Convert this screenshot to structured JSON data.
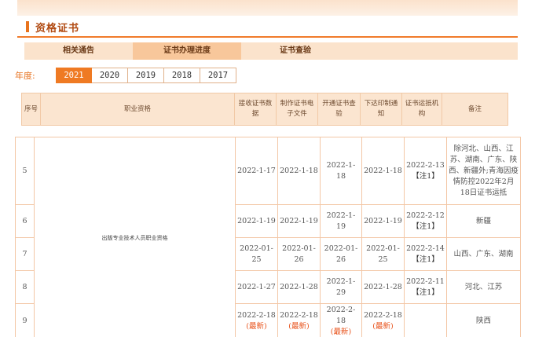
{
  "section": {
    "title": "资格证书"
  },
  "tabs": [
    {
      "label": "相关通告",
      "active": false
    },
    {
      "label": "证书办理进度",
      "active": true
    },
    {
      "label": "证书查验",
      "active": false
    }
  ],
  "years": {
    "label": "年度:",
    "options": [
      "2021",
      "2020",
      "2019",
      "2018",
      "2017"
    ],
    "selected": "2021"
  },
  "table": {
    "headers": [
      "序号",
      "职业资格",
      "接收证书数据",
      "制作证书电子文件",
      "开通证书查验",
      "下达印制通知",
      "证书运抵机构",
      "备注"
    ],
    "qualification": "出版专业技术人员职业资格",
    "rows": [
      {
        "seq": "5",
        "received": "2022-1-17",
        "made": "2022-1-18",
        "verify": "2022-1-18",
        "print": "2022-1-18",
        "arrive": "2022-2-13",
        "arrive_note": "【注1】",
        "remark": "除河北、山西、江苏、湖南、广东、陕西、新疆外;青海因疫情防控2022年2月18日证书运抵"
      },
      {
        "seq": "6",
        "received": "2022-1-19",
        "made": "2022-1-19",
        "verify": "2022-1-19",
        "print": "2022-1-19",
        "arrive": "2022-2-12",
        "arrive_note": "【注1】",
        "remark": "新疆"
      },
      {
        "seq": "7",
        "received": "2022-01-25",
        "made": "2022-01-26",
        "verify": "2022-01-26",
        "print": "2022-01-25",
        "arrive": "2022-2-14",
        "arrive_note": "【注1】",
        "remark": "山西、广东、湖南"
      },
      {
        "seq": "8",
        "received": "2022-1-27",
        "made": "2022-1-28",
        "verify": "2022-1-29",
        "print": "2022-1-28",
        "arrive": "2022-2-11",
        "arrive_note": "【注1】",
        "remark": "河北、江苏"
      },
      {
        "seq": "9",
        "received": "2022-2-18",
        "made": "2022-2-18",
        "verify": "2022-2-18",
        "print": "2022-2-18",
        "arrive": "",
        "arrive_note": "",
        "remark": "陕西",
        "new_tag": "(最新)"
      }
    ]
  },
  "colors": {
    "accent": "#ef7a23",
    "title": "#b0480f",
    "header_bg": "#fbe5d0",
    "new": "#e8531c"
  }
}
